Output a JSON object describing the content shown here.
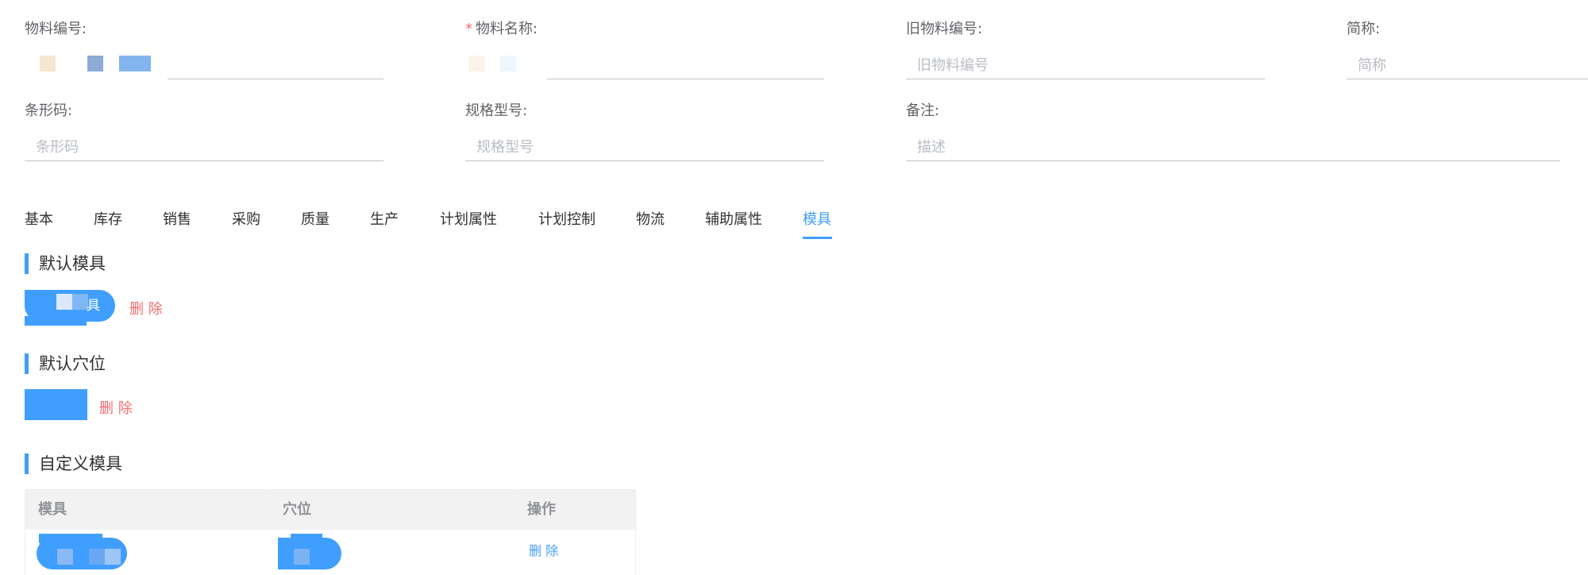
{
  "form": {
    "material_code": {
      "label": "物料编号:"
    },
    "material_name": {
      "required_mark": "*",
      "label": "物料名称:"
    },
    "old_material_code": {
      "label": "旧物料编号:",
      "placeholder": "旧物料编号"
    },
    "short_name": {
      "label": "简称:",
      "placeholder": "简称"
    },
    "barcode": {
      "label": "条形码:",
      "placeholder": "条形码"
    },
    "spec_model": {
      "label": "规格型号:",
      "placeholder": "规格型号"
    },
    "remark": {
      "label": "备注:",
      "placeholder": "描述"
    }
  },
  "tabs": [
    {
      "label": "基本"
    },
    {
      "label": "库存"
    },
    {
      "label": "销售"
    },
    {
      "label": "采购"
    },
    {
      "label": "质量"
    },
    {
      "label": "生产"
    },
    {
      "label": "计划属性"
    },
    {
      "label": "计划控制"
    },
    {
      "label": "物流"
    },
    {
      "label": "辅助属性"
    },
    {
      "label": "模具"
    }
  ],
  "active_tab": "模具",
  "sections": {
    "default_mold": {
      "title": "默认模具",
      "chip_text_tail": "具",
      "delete_label": "删 除"
    },
    "default_cavity": {
      "title": "默认穴位",
      "delete_label": "删 除"
    },
    "custom_mold": {
      "title": "自定义模具",
      "columns": [
        "模具",
        "穴位",
        "操作"
      ],
      "rows": [
        {
          "delete_label": "删 除"
        }
      ]
    }
  },
  "colors": {
    "accent": "#409eff",
    "danger": "#f56c6c",
    "text": "#606266",
    "border": "#c0c4cc",
    "header_bg": "#f2f2f2"
  }
}
